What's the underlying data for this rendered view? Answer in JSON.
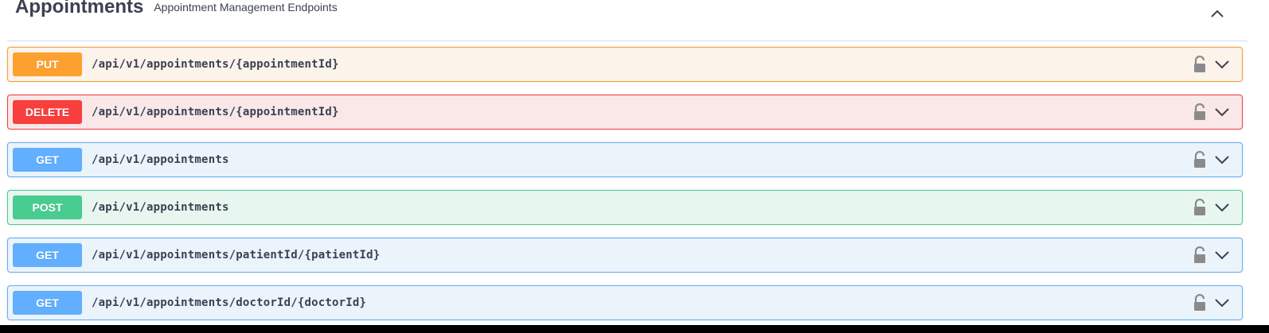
{
  "tag": {
    "title": "Appointments",
    "description": "Appointment Management Endpoints"
  },
  "operations": [
    {
      "method": "PUT",
      "path": "/api/v1/appointments/{appointmentId}",
      "color": "#fca130",
      "bg": "#fcf3ea",
      "border": "#fca130"
    },
    {
      "method": "DELETE",
      "path": "/api/v1/appointments/{appointmentId}",
      "color": "#f93e3e",
      "bg": "#fae7e7",
      "border": "#f93e3e"
    },
    {
      "method": "GET",
      "path": "/api/v1/appointments",
      "color": "#61affe",
      "bg": "#ebf3fb",
      "border": "#61affe"
    },
    {
      "method": "POST",
      "path": "/api/v1/appointments",
      "color": "#49cc90",
      "bg": "#e8f6f0",
      "border": "#49cc90"
    },
    {
      "method": "GET",
      "path": "/api/v1/appointments/patientId/{patientId}",
      "color": "#61affe",
      "bg": "#ebf3fb",
      "border": "#61affe"
    },
    {
      "method": "GET",
      "path": "/api/v1/appointments/doctorId/{doctorId}",
      "color": "#61affe",
      "bg": "#ebf3fb",
      "border": "#61affe"
    }
  ],
  "icons": {
    "collapse": "chevron-up-icon",
    "lock": "lock-icon",
    "expand": "chevron-down-icon"
  }
}
